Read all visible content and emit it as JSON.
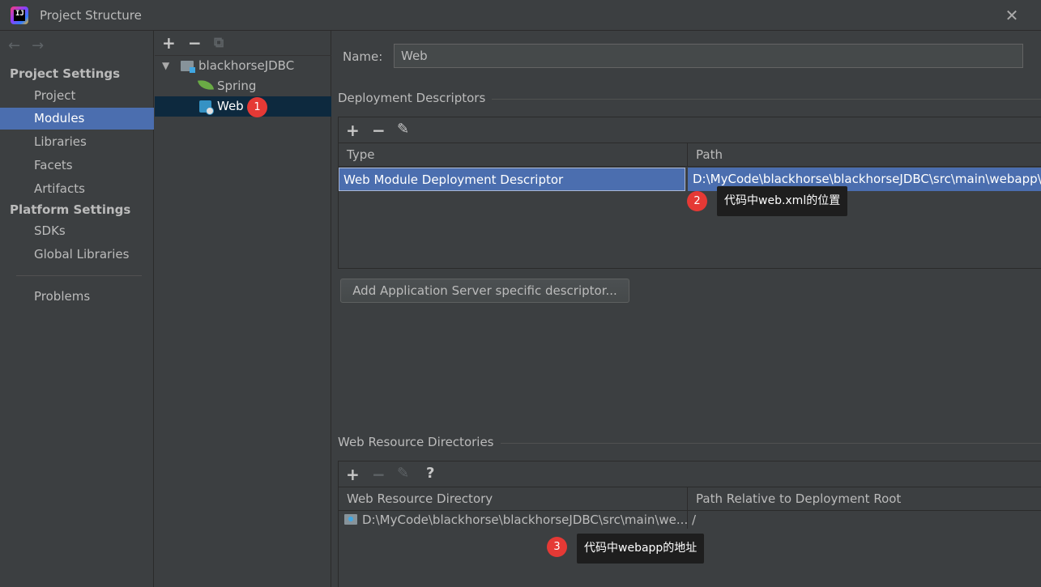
{
  "window": {
    "title": "Project Structure",
    "app_icon": "intellij-idea-icon",
    "close_glyph": "✕"
  },
  "sidebar": {
    "back_glyph": "←",
    "forward_glyph": "→",
    "project_settings_header": "Project Settings",
    "platform_settings_header": "Platform Settings",
    "project_items": [
      "Project",
      "Modules",
      "Libraries",
      "Facets",
      "Artifacts"
    ],
    "platform_items": [
      "SDKs",
      "Global Libraries"
    ],
    "problems": "Problems",
    "selected": "Modules"
  },
  "tree": {
    "toolbar": {
      "add": "+",
      "remove": "−",
      "copy": "⧉"
    },
    "nodes": [
      {
        "label": "blackhorseJDBC",
        "icon": "module-folder-icon",
        "expanded": true
      },
      {
        "label": "Spring",
        "icon": "spring-leaf-icon"
      },
      {
        "label": "Web",
        "icon": "web-facet-icon",
        "selected": true
      }
    ]
  },
  "main": {
    "name_label": "Name:",
    "name_value": "Web",
    "deployment": {
      "title": "Deployment Descriptors",
      "toolbar": {
        "add": "+",
        "remove": "−",
        "edit": "✎"
      },
      "columns": [
        "Type",
        "Path"
      ],
      "rows": [
        {
          "type": "Web Module Deployment Descriptor",
          "path": "D:\\MyCode\\blackhorse\\blackhorseJDBC\\src\\main\\webapp\\WEB-INF\\web.xml"
        }
      ]
    },
    "add_descriptor_button": "Add Application Server specific descriptor...",
    "web_resources": {
      "title": "Web Resource Directories",
      "toolbar": {
        "add": "+",
        "remove": "−",
        "edit": "✎",
        "help": "?"
      },
      "columns": [
        "Web Resource Directory",
        "Path Relative to Deployment Root"
      ],
      "rows": [
        {
          "directory": "D:\\MyCode\\blackhorse\\blackhorseJDBC\\src\\main\\we...",
          "relative": "/"
        }
      ]
    }
  },
  "annotations": [
    {
      "number": "1"
    },
    {
      "number": "2",
      "text": "代码中web.xml的位置"
    },
    {
      "number": "3",
      "text": "代码中webapp的地址"
    }
  ],
  "colors": {
    "background": "#3c3f41",
    "selection": "#4b6eaf",
    "tree_selection": "#0d293e",
    "badge": "#e53935",
    "tooltip": "#1e1e1e"
  }
}
